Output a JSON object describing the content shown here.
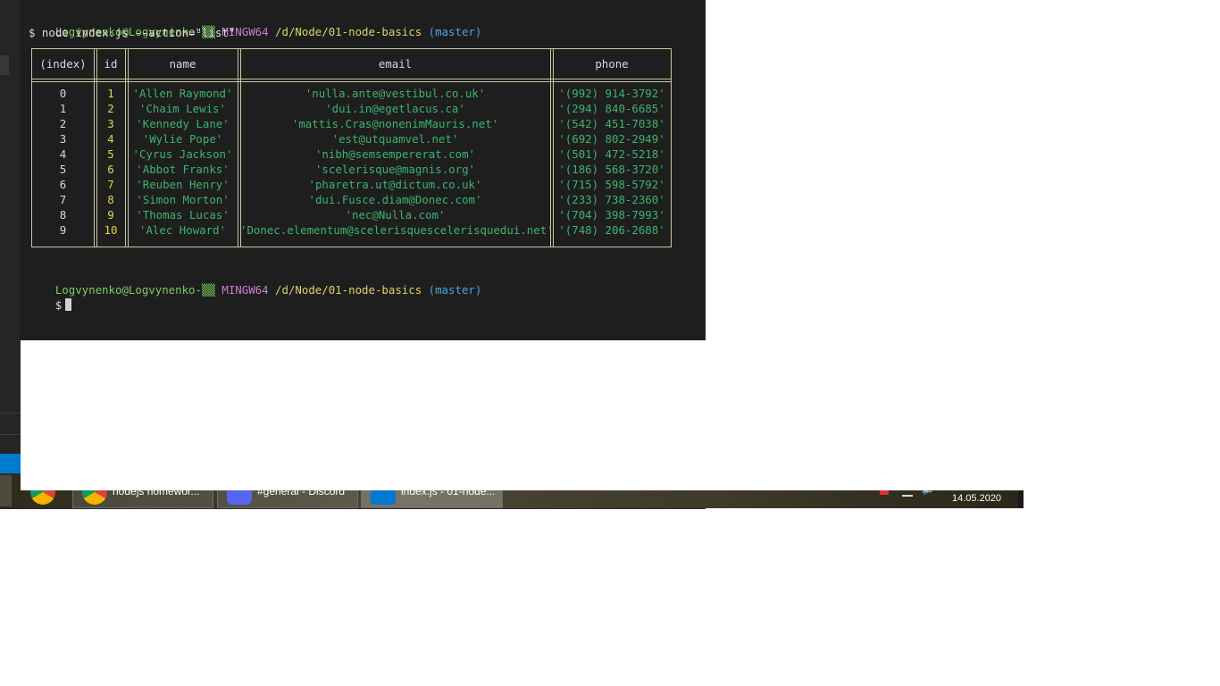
{
  "terminal": {
    "prompt1": {
      "user": "Logvynenko@Logvynenko-",
      "host_glyph": "▒▒",
      "env": "MINGW64",
      "path": "/d/Node/01-node-basics",
      "branch": "(master)"
    },
    "command": "$ node index.js --action=\"list\"",
    "table": {
      "headers": [
        "(index)",
        "id",
        "name",
        "email",
        "phone"
      ],
      "rows": [
        [
          "0",
          "1",
          "'Allen Raymond'",
          "'nulla.ante@vestibul.co.uk'",
          "'(992) 914-3792'"
        ],
        [
          "1",
          "2",
          "'Chaim Lewis'",
          "'dui.in@egetlacus.ca'",
          "'(294) 840-6685'"
        ],
        [
          "2",
          "3",
          "'Kennedy Lane'",
          "'mattis.Cras@nonenimMauris.net'",
          "'(542) 451-7038'"
        ],
        [
          "3",
          "4",
          "'Wylie Pope'",
          "'est@utquamvel.net'",
          "'(692) 802-2949'"
        ],
        [
          "4",
          "5",
          "'Cyrus Jackson'",
          "'nibh@semsempererat.com'",
          "'(501) 472-5218'"
        ],
        [
          "5",
          "6",
          "'Abbot Franks'",
          "'scelerisque@magnis.org'",
          "'(186) 568-3720'"
        ],
        [
          "6",
          "7",
          "'Reuben Henry'",
          "'pharetra.ut@dictum.co.uk'",
          "'(715) 598-5792'"
        ],
        [
          "7",
          "8",
          "'Simon Morton'",
          "'dui.Fusce.diam@Donec.com'",
          "'(233) 738-2360'"
        ],
        [
          "8",
          "9",
          "'Thomas Lucas'",
          "'nec@Nulla.com'",
          "'(704) 398-7993'"
        ],
        [
          "9",
          "10",
          "'Alec Howard'",
          "'Donec.elementum@scelerisquescelerisquedui.net'",
          "'(748) 206-2688'"
        ]
      ]
    },
    "prompt2": {
      "user": "Logvynenko@Logvynenko-",
      "host_glyph": "▒▒",
      "env": "MINGW64",
      "path": "/d/Node/01-node-basics",
      "branch": "(master)"
    },
    "input_prompt": "$"
  },
  "taskbar": {
    "items": [
      {
        "label": "nodejs homewor..."
      },
      {
        "label": "#general - Discord"
      },
      {
        "label": "index.js - 01-node..."
      }
    ],
    "clock_date": "14.05.2020"
  },
  "colors": {
    "user": "#7ecb5b",
    "env": "#c97dd3",
    "path": "#dcd26a",
    "branch": "#4aa5e0",
    "id": "#e6d44a",
    "string": "#3cb371",
    "border": "#c8c8a0"
  }
}
